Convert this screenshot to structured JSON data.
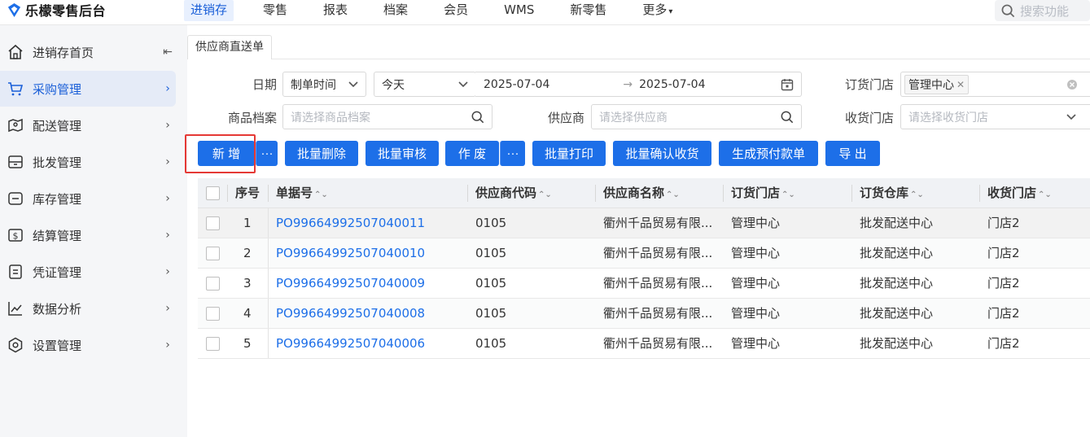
{
  "app": {
    "title": "乐檬零售后台",
    "nav": [
      {
        "label": "进销存",
        "active": true
      },
      {
        "label": "零售"
      },
      {
        "label": "报表"
      },
      {
        "label": "档案"
      },
      {
        "label": "会员"
      },
      {
        "label": "WMS"
      },
      {
        "label": "新零售"
      },
      {
        "label": "更多",
        "dropdown": true
      }
    ],
    "search_placeholder": "搜索功能",
    "accent_color": "#1d6fe8",
    "highlight_color": "#e53935"
  },
  "sidebar": {
    "items": [
      {
        "label": "进销存首页",
        "icon": "home-icon",
        "arrow": "collapse-icon"
      },
      {
        "label": "采购管理",
        "icon": "cart-icon",
        "active": true
      },
      {
        "label": "配送管理",
        "icon": "map-icon"
      },
      {
        "label": "批发管理",
        "icon": "wholesale-icon"
      },
      {
        "label": "库存管理",
        "icon": "inventory-icon"
      },
      {
        "label": "结算管理",
        "icon": "settlement-icon"
      },
      {
        "label": "凭证管理",
        "icon": "voucher-icon"
      },
      {
        "label": "数据分析",
        "icon": "chart-icon"
      },
      {
        "label": "设置管理",
        "icon": "settings-icon"
      }
    ]
  },
  "tab": {
    "label": "供应商直送单"
  },
  "filters": {
    "date_label": "日期",
    "date_type": "制单时间",
    "date_range": "今天",
    "date_start": "2025-07-04",
    "date_end": "2025-07-04",
    "order_store_label": "订货门店",
    "order_store_tag": "管理中心",
    "product_label": "商品档案",
    "product_placeholder": "请选择商品档案",
    "supplier_label": "供应商",
    "supplier_placeholder": "请选择供应商",
    "receive_store_label": "收货门店",
    "receive_store_placeholder": "请选择收货门店"
  },
  "actions": {
    "add": "新 增",
    "more": "···",
    "batch_delete": "批量删除",
    "batch_audit": "批量审核",
    "void": "作 废",
    "batch_print": "批量打印",
    "batch_confirm": "批量确认收货",
    "gen_prepay": "生成预付款单",
    "export": "导 出"
  },
  "table": {
    "headers": {
      "index": "序号",
      "doc_no": "单据号",
      "supplier_code": "供应商代码",
      "supplier_name": "供应商名称",
      "order_store": "订货门店",
      "order_warehouse": "订货仓库",
      "receive_store": "收货门店"
    },
    "sort_icon": "⌃⌄",
    "rows": [
      {
        "index": "1",
        "doc_no": "PO99664992507040011",
        "supplier_code": "0105",
        "supplier_name": "衢州千品贸易有限...",
        "order_store": "管理中心",
        "order_warehouse": "批发配送中心",
        "receive_store": "门店2"
      },
      {
        "index": "2",
        "doc_no": "PO99664992507040010",
        "supplier_code": "0105",
        "supplier_name": "衢州千品贸易有限...",
        "order_store": "管理中心",
        "order_warehouse": "批发配送中心",
        "receive_store": "门店2"
      },
      {
        "index": "3",
        "doc_no": "PO99664992507040009",
        "supplier_code": "0105",
        "supplier_name": "衢州千品贸易有限...",
        "order_store": "管理中心",
        "order_warehouse": "批发配送中心",
        "receive_store": "门店2"
      },
      {
        "index": "4",
        "doc_no": "PO99664992507040008",
        "supplier_code": "0105",
        "supplier_name": "衢州千品贸易有限...",
        "order_store": "管理中心",
        "order_warehouse": "批发配送中心",
        "receive_store": "门店2"
      },
      {
        "index": "5",
        "doc_no": "PO99664992507040006",
        "supplier_code": "0105",
        "supplier_name": "衢州千品贸易有限...",
        "order_store": "管理中心",
        "order_warehouse": "批发配送中心",
        "receive_store": "门店2"
      }
    ]
  }
}
